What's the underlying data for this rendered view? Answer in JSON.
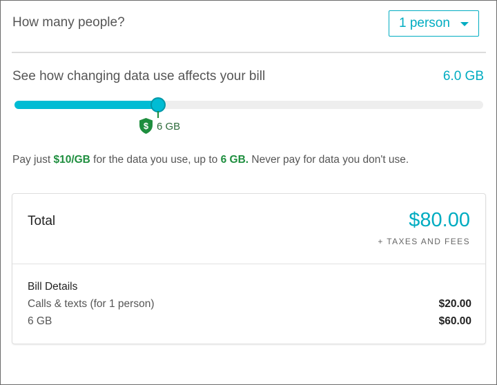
{
  "people": {
    "question": "How many people?",
    "selected": "1 person"
  },
  "data_use": {
    "label": "See how changing data use affects your bill",
    "value_text": "6.0 GB",
    "slider_fraction": 0.307,
    "marker_label": "6 GB"
  },
  "pay_line": {
    "prefix": "Pay just ",
    "rate": "$10/GB",
    "middle": " for the data you use, up to ",
    "cap": "6 GB.",
    "suffix": " Never pay for data you don't use."
  },
  "summary": {
    "total_label": "Total",
    "total_amount": "$80.00",
    "taxes_note": "+ TAXES AND FEES",
    "details_title": "Bill Details",
    "rows": [
      {
        "label": "Calls & texts (for 1 person)",
        "amount": "$20.00"
      },
      {
        "label": "6 GB",
        "amount": "$60.00"
      }
    ]
  },
  "colors": {
    "accent": "#00bcd4",
    "accent_text": "#00acc1",
    "money_green": "#1e8e3e"
  },
  "icons": {
    "dropdown": "caret-down-icon",
    "marker": "dollar-shield-icon"
  }
}
